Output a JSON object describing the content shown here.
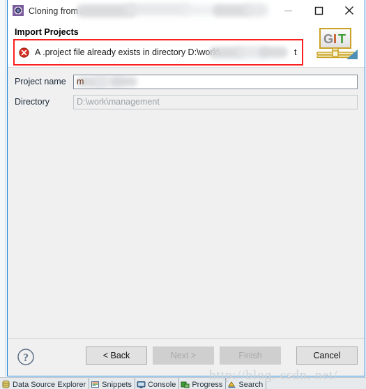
{
  "window": {
    "title": "Cloning from .",
    "title_redacted": true,
    "icon": "eclipse-git-clone-icon",
    "controls": {
      "minimize": {
        "name": "minimize-button",
        "glyph": "—",
        "enabled": false
      },
      "maximize": {
        "name": "maximize-button",
        "glyph": "☐",
        "enabled": true
      },
      "close": {
        "name": "close-button",
        "glyph": "✕",
        "enabled": true
      }
    },
    "accent_border": "#1883d7"
  },
  "header": {
    "page_title": "Import Projects",
    "error": {
      "icon": "error-circle-x-icon",
      "message": "A .project file already exists in directory D:\\work\\",
      "message_tail": "t",
      "redacted": true,
      "box_border_color": "#fb1f1f",
      "icon_color": "#d92d20"
    },
    "logo": {
      "name": "git-logo",
      "text": "GIT",
      "letter_colors": [
        "#8a8a8a",
        "#c4551f",
        "#3f9c35"
      ]
    }
  },
  "form": {
    "fields": [
      {
        "label": "Project name",
        "value": "m",
        "value_redacted": true,
        "placeholder": "",
        "enabled": true,
        "name": "project-name-field"
      },
      {
        "label": "Directory",
        "value": "D:\\work\\management",
        "value_redacted": false,
        "placeholder": "",
        "enabled": false,
        "name": "directory-field"
      }
    ]
  },
  "footer": {
    "help_icon": "help-question-icon",
    "buttons": [
      {
        "label": "< Back",
        "enabled": true,
        "name": "back-button"
      },
      {
        "label": "Next >",
        "enabled": false,
        "name": "next-button"
      },
      {
        "label": "Finish",
        "enabled": false,
        "name": "finish-button"
      },
      {
        "label": "Cancel",
        "enabled": true,
        "name": "cancel-button"
      }
    ]
  },
  "workbench": {
    "view_tabs": [
      {
        "label": "Data Source Explorer",
        "icon": "database-icon",
        "name": "tab-data-source-explorer"
      },
      {
        "label": "Snippets",
        "icon": "snippets-icon",
        "name": "tab-snippets"
      },
      {
        "label": "Console",
        "icon": "console-icon",
        "name": "tab-console"
      },
      {
        "label": "Progress",
        "icon": "progress-icon",
        "name": "tab-progress"
      },
      {
        "label": "Search",
        "icon": "search-icon",
        "name": "tab-search"
      }
    ]
  },
  "watermark": {
    "text": "http://blog. csdn. net/"
  }
}
